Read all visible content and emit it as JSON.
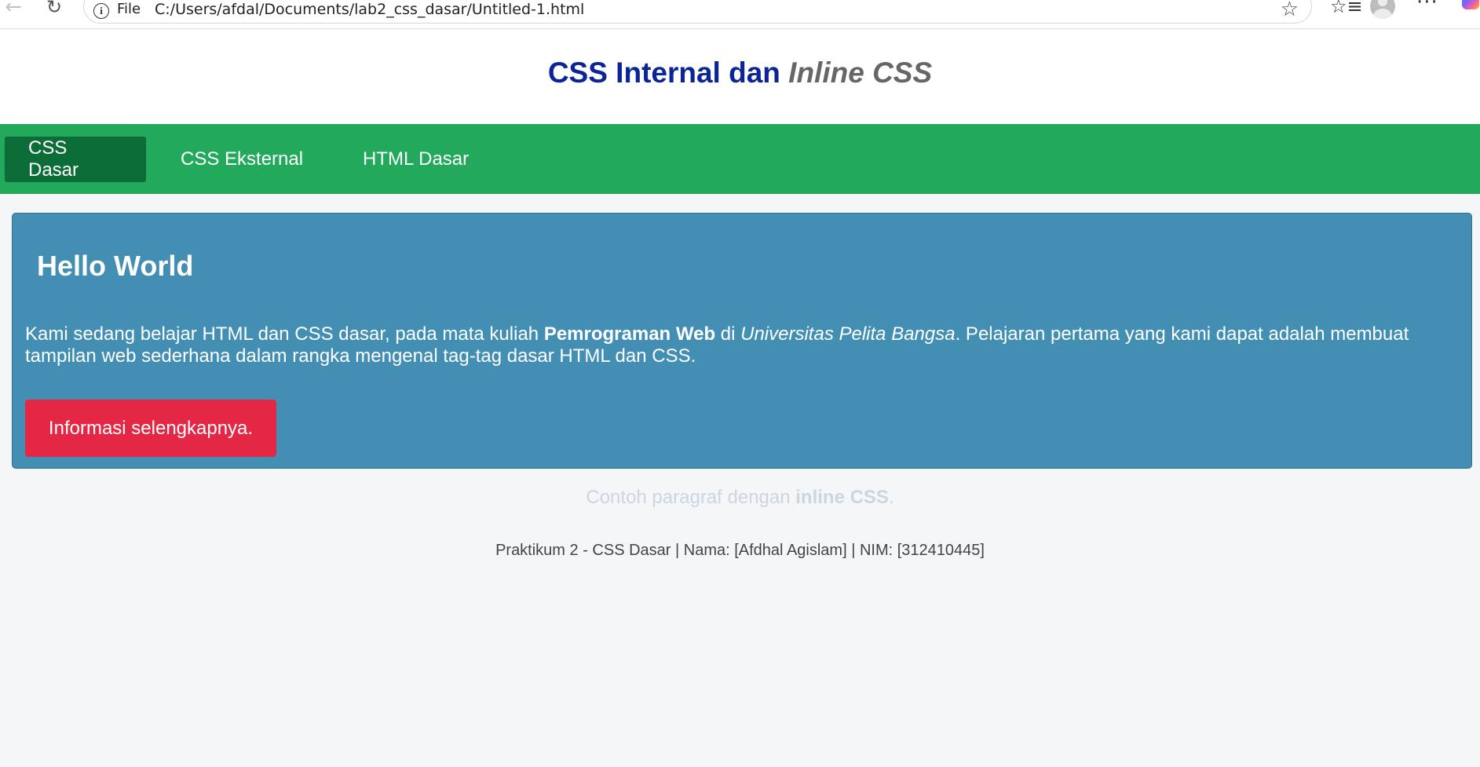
{
  "browser": {
    "address_label": "File",
    "url": "C:/Users/afdal/Documents/lab2_css_dasar/Untitled-1.html",
    "more_label": "···"
  },
  "header": {
    "title_part1": "CSS Internal dan ",
    "title_italic_word": "Inline",
    "title_italic_rest": " CSS"
  },
  "nav": {
    "items": [
      {
        "label": "CSS Dasar",
        "active": true
      },
      {
        "label": "CSS Eksternal",
        "active": false
      },
      {
        "label": "HTML Dasar",
        "active": false
      }
    ]
  },
  "hero": {
    "title": "Hello World",
    "text_1": "Kami sedang belajar HTML dan CSS dasar, pada mata kuliah ",
    "text_bold": "Pemrograman Web",
    "text_2": " di ",
    "text_italic": "Universitas Pelita Bangsa",
    "text_3": ". Pelajaran pertama yang kami dapat adalah membuat tampilan web sederhana dalam rangka mengenal tag-tag dasar HTML dan CSS.",
    "button_label": "Informasi selengkapnya."
  },
  "inline_paragraph": {
    "text_1": "Contoh paragraf dengan ",
    "text_bold": "inline CSS",
    "text_2": "."
  },
  "footer": {
    "text": "Praktikum 2 - CSS Dasar | Nama: [Afdhal Agislam] | NIM: [312410445]"
  },
  "colors": {
    "header_title": "#0b2497",
    "nav_background": "#22a95b",
    "nav_active": "#0d6d38",
    "hero_background": "#428fb3",
    "button_background": "#e32745",
    "page_background": "#f4f6f8"
  },
  "icons": [
    "back-arrow-icon",
    "reload-icon",
    "info-icon",
    "star-icon",
    "favorites-icon",
    "avatar",
    "more-icon",
    "copilot-icon"
  ]
}
